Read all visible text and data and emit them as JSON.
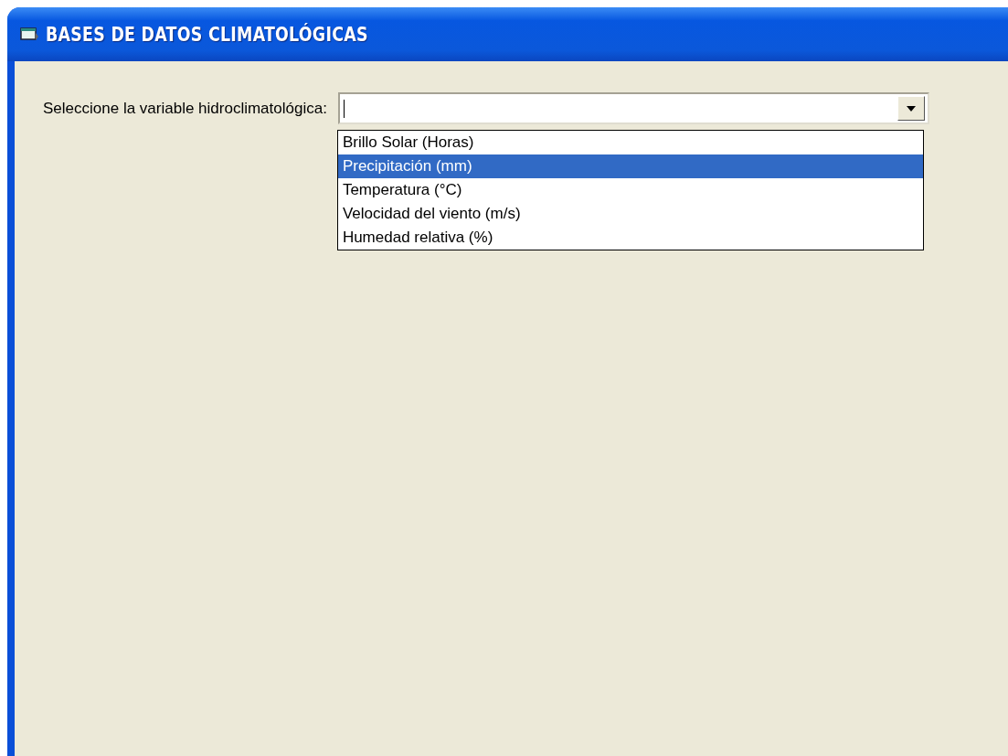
{
  "window": {
    "title": "BASES DE DATOS CLIMATOLÓGICAS"
  },
  "variable_select": {
    "label": "Seleccione la variable hidroclimatológica:",
    "expanded": true,
    "options": [
      {
        "label": "Brillo Solar (Horas)",
        "selected": false
      },
      {
        "label": "Precipitación (mm)",
        "selected": true
      },
      {
        "label": "Temperatura (°C)",
        "selected": false
      },
      {
        "label": "Velocidad del viento (m/s)",
        "selected": false
      },
      {
        "label": "Humedad relativa (%)",
        "selected": false
      }
    ]
  }
}
